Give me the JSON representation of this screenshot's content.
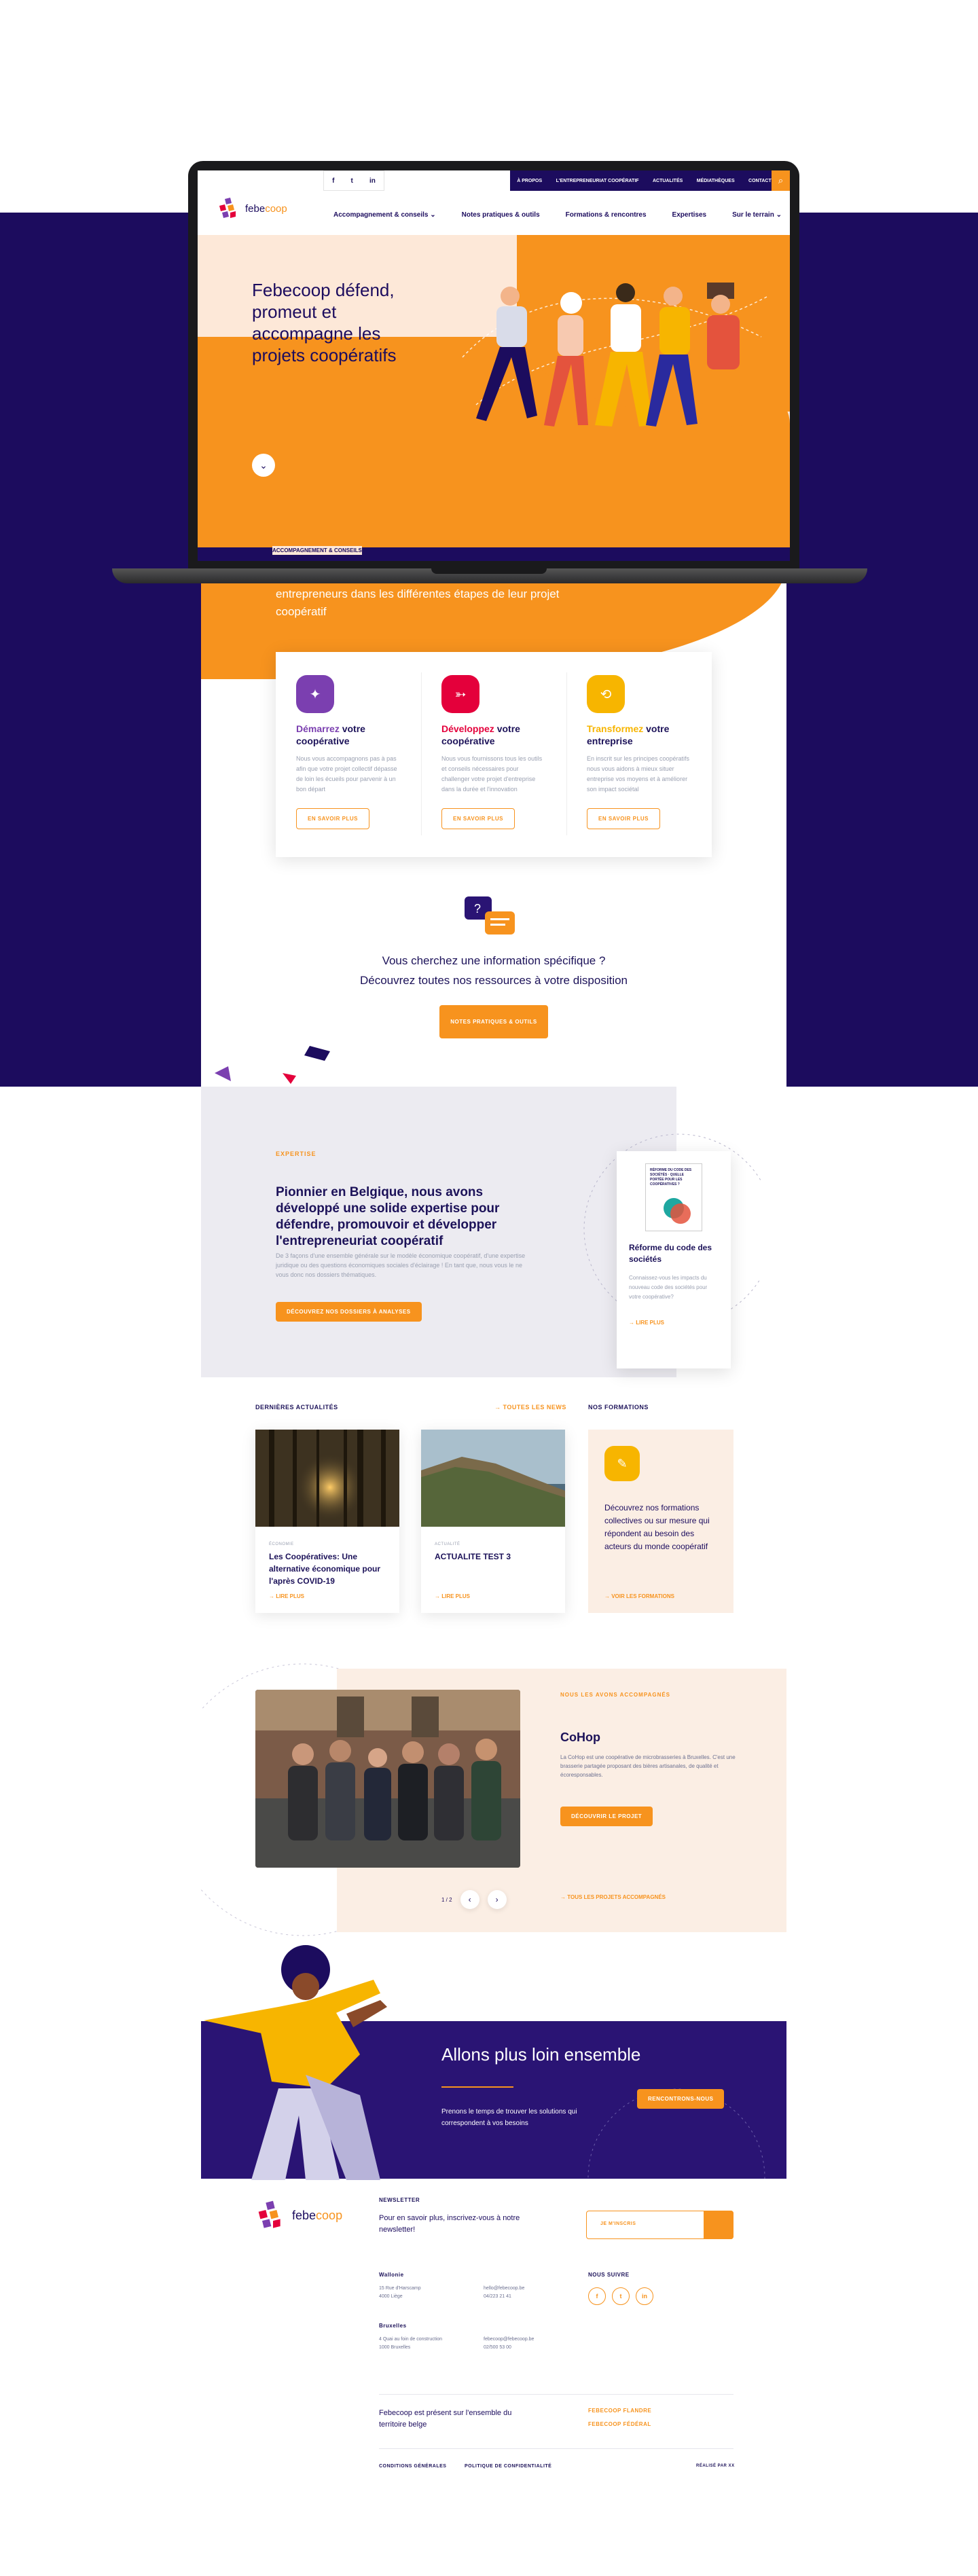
{
  "laptop": {
    "social": [
      "f",
      "t",
      "in"
    ],
    "top_menu": [
      "À PROPOS",
      "L'ENTREPRENEURIAT COOPÉRATIF",
      "ACTUALITÉS",
      "MÉDIATHÈQUES",
      "CONTACT"
    ],
    "logo_text_a": "febe",
    "logo_text_b": "coop",
    "main_nav": [
      "Accompagnement & conseils ⌄",
      "Notes pratiques & outils",
      "Formations & rencontres",
      "Expertises",
      "Sur le terrain ⌄"
    ],
    "hero_title": "Febecoop défend, promeut et accompagne les projets coopératifs",
    "hero_band_label": "ACCOMPAGNEMENT & CONSEILS"
  },
  "subhero": "entrepreneurs dans les différentes étapes de leur projet coopératif",
  "cards": [
    {
      "title_accent": "Démarrez",
      "title_rest": " votre coopérative",
      "accent": "#7b3fb0",
      "text": "Nous vous accompagnons pas à pas afin que votre projet collectif dépasse de loin les écueils pour parvenir à un bon départ",
      "button": "EN SAVOIR PLUS"
    },
    {
      "title_accent": "Développez",
      "title_rest": " votre coopérative",
      "accent": "#e4003b",
      "text": "Nous vous fournissons tous les outils et conseils nécessaires pour challenger votre projet d'entreprise dans la durée et l'innovation",
      "button": "EN SAVOIR PLUS"
    },
    {
      "title_accent": "Transformez",
      "title_rest": " votre entreprise",
      "accent": "#f7b500",
      "text": "En inscrit sur les principes coopératifs nous vous aidons à mieux situer entreprise vos moyens et à améliorer son impact sociétal",
      "button": "EN SAVOIR PLUS"
    }
  ],
  "question": {
    "line1": "Vous cherchez une information spécifique ?",
    "line2": "Découvrez toutes nos ressources à votre disposition",
    "button": "NOTES PRATIQUES & OUTILS"
  },
  "expertise": {
    "tag": "EXPERTISE",
    "title": "Pionnier en Belgique, nous avons développé une solide expertise pour défendre, promouvoir et développer l'entrepreneuriat coopératif",
    "text": "De 3 façons d'une ensemble générale sur le modèle économique coopératif, d'une expertise juridique ou des questions économiques sociales d'éclairage ! En tant que, nous vous le ne vous donc nos dossiers thématiques.",
    "button": "DÉCOUVREZ NOS DOSSIERS À ANALYSES",
    "pub_book": "RÉFORME DU CODE DES SOCIÉTÉS · QUELLE PORTÉE POUR LES COOPÉRATIVES ?",
    "pub_title": "Réforme du code des sociétés",
    "pub_text": "Connaissez-vous les impacts du nouveau code des sociétés pour votre coopérative?",
    "pub_more": "→ LIRE PLUS"
  },
  "news": {
    "label": "DERNIÈRES ACTUALITÉS",
    "all": "TOUTES LES NEWS",
    "items": [
      {
        "cat": "ÉCONOMIE",
        "title": "Les Coopératives: Une alternative économique pour l'après COVID-19",
        "more": "→ LIRE PLUS"
      },
      {
        "cat": "ACTUALITÉ",
        "title": "ACTUALITE TEST 3",
        "more": "→ LIRE PLUS"
      }
    ],
    "formations_label": "NOS FORMATIONS",
    "formations_text": "Découvrez nos formations collectives ou sur mesure qui répondent au besoin des acteurs du monde coopératif",
    "formations_more": "→ VOIR LES FORMATIONS"
  },
  "cohop": {
    "tag": "NOUS LES AVONS ACCOMPAGNÉS",
    "title": "CoHop",
    "text": "La CoHop est une coopérative de microbrasseries à Bruxelles. C'est une brasserie partagée proposant des bières artisanales, de qualité et écoresponsables.",
    "button": "DÉCOUVRIR LE PROJET",
    "pager": "1 / 2",
    "more": "→ TOUS LES PROJETS ACCOMPAGNÉS"
  },
  "cta": {
    "title": "Allons plus loin ensemble",
    "text": "Prenons le temps de trouver les solutions qui correspondent à vos besoins",
    "button": "RENCONTRONS-NOUS"
  },
  "footer": {
    "newsletter_label": "NEWSLETTER",
    "newsletter_text": "Pour en savoir plus, inscrivez-vous à notre newsletter!",
    "newsletter_placeholder": "JE M'INSCRIS",
    "wallonie_label": "Wallonie",
    "wallonie_addr": "15 Rue d'Harscamp\n4000 Liège",
    "wallonie_contact": "hello@febecoop.be\n04/223 21 41",
    "bruxelles_label": "Bruxelles",
    "bruxelles_addr": "4 Quai au foin de construction\n1000 Bruxelles",
    "bruxelles_contact": "febecoop@febecoop.be\n02/500 53 00",
    "follow_label": "NOUS SUIVRE",
    "social": [
      "f",
      "t",
      "in"
    ],
    "presence": "Febecoop est présent sur l'ensemble du territoire belge",
    "region1": "FEBECOOP FLANDRE",
    "region2": "FEBECOOP FÉDÉRAL",
    "legal1": "CONDITIONS GÉNÉRALES",
    "legal2": "POLITIQUE DE CONFIDENTIALITÉ",
    "credit": "RÉALISÉ PAR XX"
  }
}
